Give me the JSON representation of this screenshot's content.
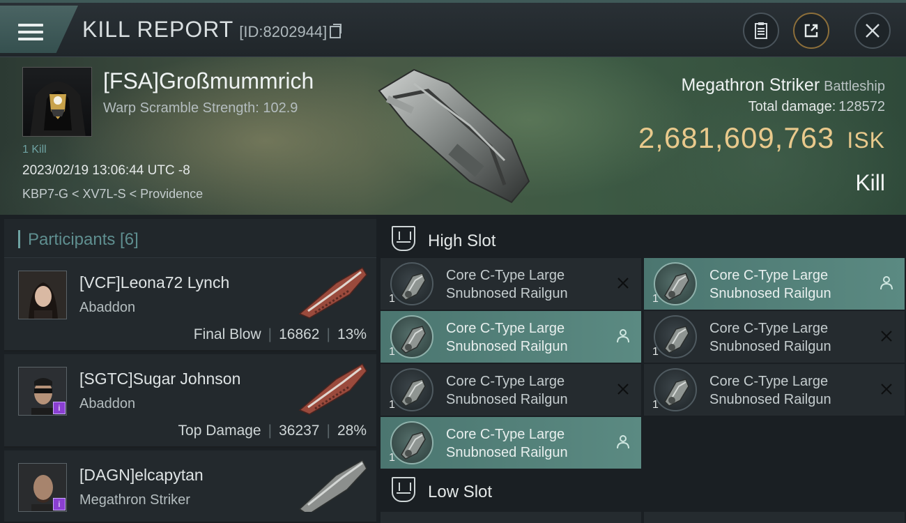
{
  "header": {
    "title": "KILL REPORT",
    "id_text": "[ID:8202944]"
  },
  "victim": {
    "name": "[FSA]Großmummrich",
    "warp_scramble": "Warp Scramble Strength: 102.9",
    "kills": "1 Kill",
    "datetime": "2023/02/19 13:06:44 UTC -8",
    "location": "KBP7-G < XV7L-S < Providence",
    "ship": "Megathron Striker",
    "ship_class": "Battleship",
    "total_damage_label": "Total damage:",
    "total_damage": "128572",
    "isk_value": "2,681,609,763",
    "isk_unit": "ISK",
    "result": "Kill"
  },
  "participants": {
    "header": "Participants [6]",
    "rows": [
      {
        "name": "[VCF]Leona72 Lynch",
        "ship": "Abaddon",
        "tag": "Final Blow",
        "damage": "16862",
        "percent": "13%"
      },
      {
        "name": "[SGTC]Sugar Johnson",
        "ship": "Abaddon",
        "tag": "Top Damage",
        "damage": "36237",
        "percent": "28%"
      },
      {
        "name": "[DAGN]elcapytan",
        "ship": "Megathron Striker"
      }
    ]
  },
  "slots": {
    "high_label": "High Slot",
    "low_label": "Low Slot",
    "high_modules": [
      {
        "name": "Core C-Type Large Snubnosed Railgun",
        "qty": "1",
        "state": "destroyed"
      },
      {
        "name": "Core C-Type Large Snubnosed Railgun",
        "qty": "1",
        "state": "dropped"
      },
      {
        "name": "Core C-Type Large Snubnosed Railgun",
        "qty": "1",
        "state": "dropped"
      },
      {
        "name": "Core C-Type Large Snubnosed Railgun",
        "qty": "1",
        "state": "destroyed"
      },
      {
        "name": "Core C-Type Large Snubnosed Railgun",
        "qty": "1",
        "state": "destroyed"
      },
      {
        "name": "Core C-Type Large Snubnosed Railgun",
        "qty": "1",
        "state": "destroyed"
      },
      {
        "name": "Core C-Type Large Snubnosed Railgun",
        "qty": "1",
        "state": "dropped"
      }
    ]
  },
  "colors": {
    "accent_teal": "#5b8a82",
    "isk_gold": "#e9c98c",
    "badge_purple": "#8a3fd1"
  },
  "icons": [
    "menu-icon",
    "copy-icon",
    "clipboard-icon",
    "share-icon",
    "close-icon",
    "high-slot-icon",
    "low-slot-icon",
    "destroyed-x-icon",
    "dropped-person-icon"
  ]
}
